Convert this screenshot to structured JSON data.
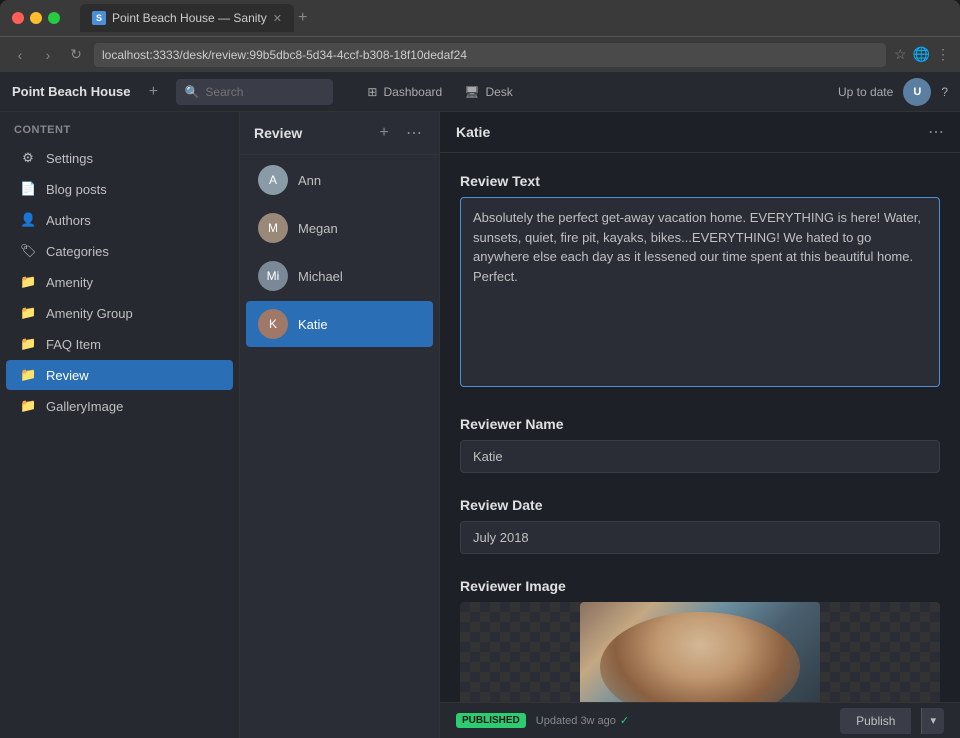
{
  "browser": {
    "tab_label": "Point Beach House — Sanity",
    "tab_favicon": "S",
    "address": "localhost:3333/desk/review:99b5dbc8-5d34-4ccf-b308-18f10dedaf24"
  },
  "topbar": {
    "app_title": "Point Beach House",
    "add_label": "+",
    "search_placeholder": "Search",
    "nav_items": [
      {
        "icon": "⊞",
        "label": "Dashboard"
      },
      {
        "icon": "🖥",
        "label": "Desk"
      }
    ],
    "status": "Up to date"
  },
  "sidebar": {
    "section_label": "Content",
    "items": [
      {
        "icon": "⚙",
        "label": "Settings",
        "id": "settings"
      },
      {
        "icon": "📄",
        "label": "Blog posts",
        "id": "blog-posts"
      },
      {
        "icon": "👤",
        "label": "Authors",
        "id": "authors"
      },
      {
        "icon": "🏷",
        "label": "Categories",
        "id": "categories"
      },
      {
        "icon": "📁",
        "label": "Amenity",
        "id": "amenity"
      },
      {
        "icon": "📁",
        "label": "Amenity Group",
        "id": "amenity-group"
      },
      {
        "icon": "📁",
        "label": "FAQ Item",
        "id": "faq-item"
      },
      {
        "icon": "📁",
        "label": "Review",
        "id": "review",
        "active": true
      },
      {
        "icon": "📁",
        "label": "GalleryImage",
        "id": "gallery-image"
      }
    ]
  },
  "review_panel": {
    "title": "Review",
    "reviewers": [
      {
        "name": "Ann",
        "id": "ann",
        "initials": "A",
        "color": "#8a9ba8"
      },
      {
        "name": "Megan",
        "id": "megan",
        "initials": "M",
        "color": "#9a8878"
      },
      {
        "name": "Michael",
        "id": "michael",
        "initials": "Mi",
        "color": "#7a8898"
      },
      {
        "name": "Katie",
        "id": "katie",
        "initials": "K",
        "color": "#a07868",
        "active": true
      }
    ]
  },
  "detail": {
    "title": "Katie",
    "review_text_label": "Review Text",
    "review_text_value": "Absolutely the perfect get-away vacation home. EVERYTHING is here! Water, sunsets, quiet, fire pit, kayaks, bikes...EVERYTHING! We hated to go anywhere else each day as it lessened our time spent at this beautiful home. Perfect.",
    "reviewer_name_label": "Reviewer Name",
    "reviewer_name_value": "Katie",
    "review_date_label": "Review Date",
    "review_date_value": "July 2018",
    "reviewer_image_label": "Reviewer Image"
  },
  "bottom_bar": {
    "published_label": "PUBLISHED",
    "updated_text": "Updated 3w ago",
    "publish_button_label": "Publish",
    "dropdown_icon": "▾"
  },
  "icons": {
    "add": "+",
    "search": "🔍",
    "ellipsis": "•••",
    "chevron_down": "▾",
    "check": "✓",
    "back": "‹",
    "forward": "›",
    "reload": "↻",
    "star": "☆",
    "menu": "⋮",
    "globe": "🌐"
  }
}
